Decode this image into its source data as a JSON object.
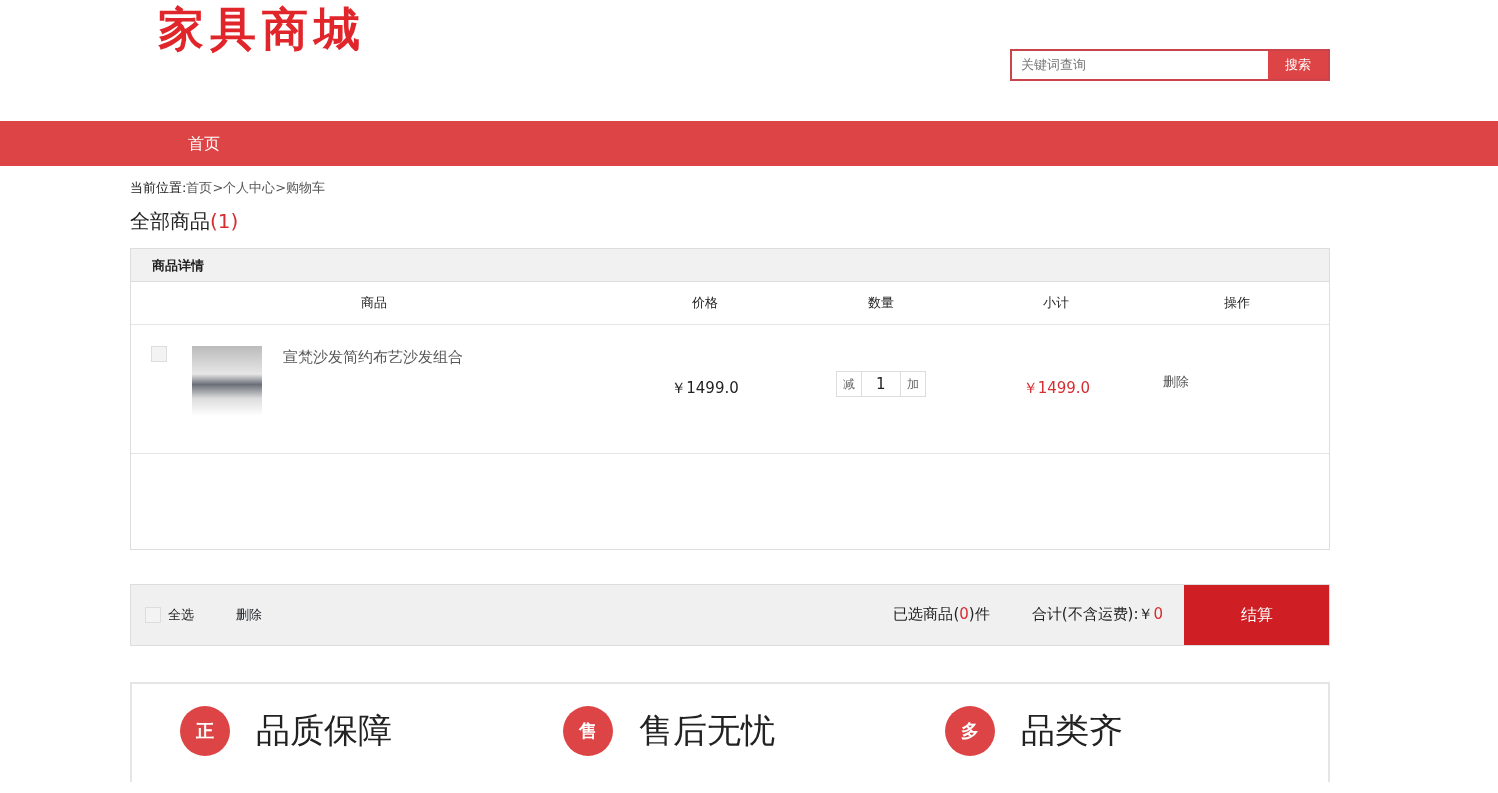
{
  "logo": "家具商城",
  "search": {
    "placeholder": "关键词查询",
    "button": "搜索"
  },
  "nav": [
    {
      "label": "首页",
      "selected": false
    }
  ],
  "breadcrumb": {
    "label": "当前位置:",
    "trail": "首页>个人中心>购物车"
  },
  "heading": {
    "title": "全部商品",
    "count": "(1)"
  },
  "cart": {
    "section_title": "商品详情",
    "columns": [
      "商品",
      "价格",
      "数量",
      "小计",
      "操作"
    ],
    "rows": [
      {
        "checked": false,
        "name": "宣梵沙发简约布艺沙发组合",
        "price": "￥1499.0",
        "decrease": "减",
        "quantity": "1",
        "increase": "加",
        "subtotal": "￥1499.0",
        "action": "删除"
      }
    ]
  },
  "footer_bar": {
    "select_all": {
      "label": "全选",
      "checked": false
    },
    "delete": "删除",
    "selected_prefix": "已选商品(",
    "selected_count": "0",
    "selected_suffix": ")件",
    "total_label": "合计(不含运费):￥",
    "total": "0",
    "checkout": "结算"
  },
  "features": [
    {
      "icon_char": "正",
      "label": "品质保障"
    },
    {
      "icon_char": "售",
      "label": "售后无忧"
    },
    {
      "icon_char": "多",
      "label": "品类齐"
    }
  ]
}
